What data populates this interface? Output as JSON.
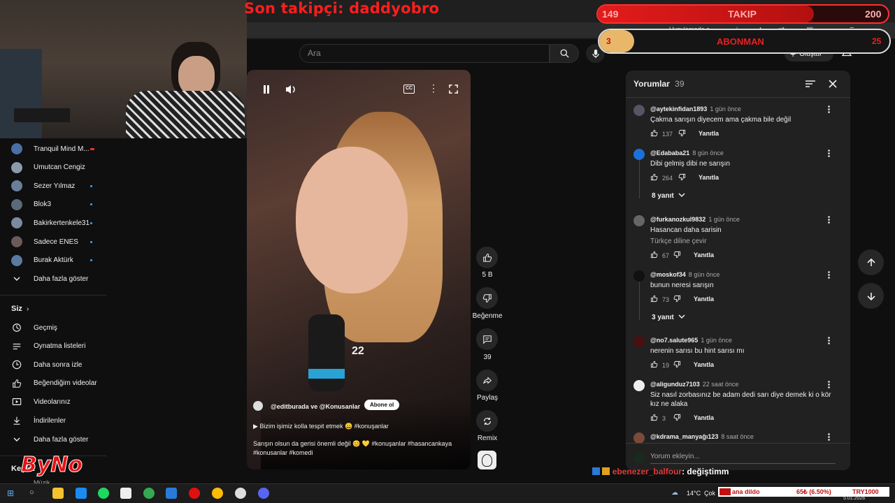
{
  "overlay": {
    "last_follower": "Son takipçi: daddyobro",
    "follow_goal": {
      "label": "TAKIP",
      "current": "149",
      "target": "200",
      "progress": 0.745
    },
    "sub_goal": {
      "label": "ABONMAN",
      "current": "3",
      "target": "25",
      "progress": 0.12
    },
    "chat_user": "ebenezer_balfour",
    "chat_message": ": değiştimm",
    "brand_text": "ByNo",
    "ticker": {
      "text": "ana dildo",
      "change": "65₺ (6.50%)",
      "currency": "TRY1000"
    }
  },
  "browser": {
    "bookmarks_label": "Uygulamada a..."
  },
  "youtube": {
    "search_placeholder": "Ara",
    "create_label": "Oluştur",
    "notif_count": "9+"
  },
  "sidebar": {
    "subscriptions": [
      {
        "label": "Tranquil Mind M...",
        "dot": "live",
        "color": "#4a6fa5"
      },
      {
        "label": "Umutcan Cengiz",
        "dot": "none",
        "color": "#8a9aaa"
      },
      {
        "label": "Sezer Yılmaz",
        "dot": "new",
        "color": "#6a7f9a"
      },
      {
        "label": "Blok3",
        "dot": "new",
        "color": "#5a6a7a"
      },
      {
        "label": "Bakirkertenkele31",
        "dot": "new",
        "color": "#7a8aa0"
      },
      {
        "label": "Sadece ENES",
        "dot": "new",
        "color": "#6a5a5a"
      },
      {
        "label": "Burak Aktürk",
        "dot": "new",
        "color": "#5a7aa0"
      }
    ],
    "show_more": "Daha fazla göster",
    "you_section": "Siz",
    "you_items": [
      {
        "label": "Geçmiş",
        "icon": "history-icon"
      },
      {
        "label": "Oynatma listeleri",
        "icon": "playlist-icon"
      },
      {
        "label": "Daha sonra izle",
        "icon": "clock-icon"
      },
      {
        "label": "Beğendiğim videolar",
        "icon": "thumb-up-icon"
      },
      {
        "label": "Videolarınız",
        "icon": "video-icon"
      },
      {
        "label": "İndirilenler",
        "icon": "download-icon"
      }
    ],
    "show_more_2": "Daha fazla göster",
    "explore": "Keşfet",
    "music": "Müzik"
  },
  "video": {
    "overlay_number": "22",
    "channel": "@editburada ve @Konusanlar",
    "subscribe": "Abone ol",
    "playlist_label": "Bizim işimiz kolla tespit etmek 😄 #konuşanlar",
    "caption": "Sarışın olsun da gerisi önemli değil 😊 💛 #konuşanlar #hasancankaya #konusanlar  #komedi",
    "likes": "5 B",
    "dislike_label": "Beğenme",
    "comments_count": "39",
    "share_label": "Paylaş",
    "remix_label": "Remix"
  },
  "comments": {
    "title": "Yorumlar",
    "count": "39",
    "add_placeholder": "Yorum ekleyin...",
    "reply_label": "Yanıtla",
    "items": [
      {
        "user": "@aytekinfidan1893",
        "time": "1 gün önce",
        "text": "Çakma sarışın diyecem ama çakma bile değil",
        "likes": "137",
        "color": "#556"
      },
      {
        "user": "@Edababa21",
        "time": "8 gün önce",
        "text": "Dibi gelmiş dibi ne sarışın",
        "likes": "264",
        "color": "#1e6fd9",
        "replies": "8 yanıt"
      },
      {
        "user": "@furkanozkul9832",
        "time": "1 gün önce",
        "text": "Hasancan daha sarisin",
        "translate": "Türkçe diline çevir",
        "likes": "67",
        "color": "#666"
      },
      {
        "user": "@moskof34",
        "time": "8 gün önce",
        "text": "bunun neresi sarışın",
        "likes": "73",
        "color": "#111",
        "replies": "3 yanıt"
      },
      {
        "user": "@no7.salute965",
        "time": "1 gün önce",
        "text": "nerenin sarısı bu hint sarısı mı",
        "likes": "19",
        "color": "#4a1010"
      },
      {
        "user": "@aligunduz7103",
        "time": "22 saat önce",
        "text": "Siz nasıl zorbasınız be adam dedi sarı diye demek ki o kör kız ne alaka",
        "likes": "3",
        "color": "#eee"
      },
      {
        "user": "@kdrama_manyağı123",
        "time": "8 saat önce",
        "text": "",
        "likes": "",
        "color": "#7a4a3a"
      }
    ]
  },
  "taskbar": {
    "weather": "14°C",
    "weather_desc": "Çok",
    "date": "5.01.2026"
  }
}
